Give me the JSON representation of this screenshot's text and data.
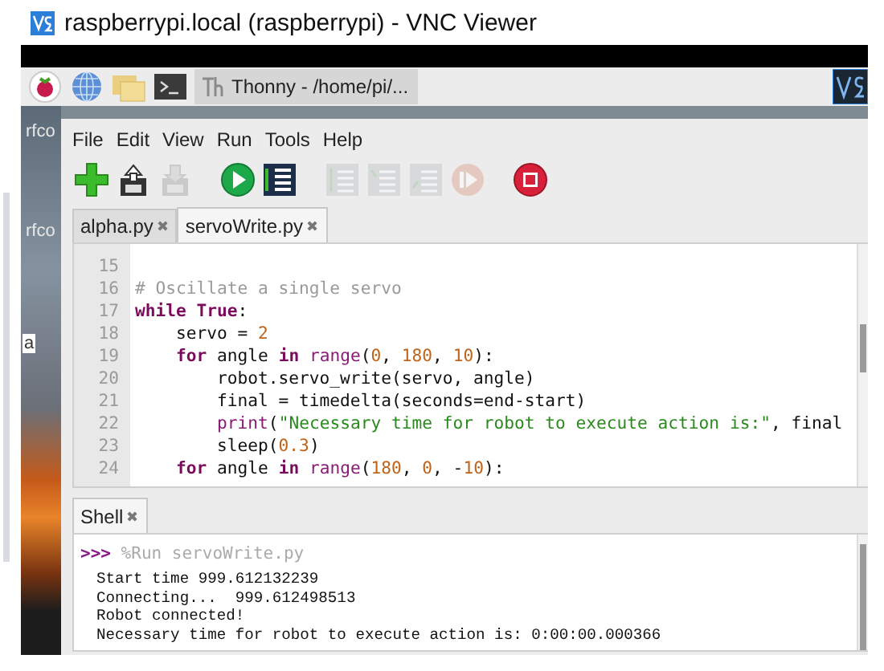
{
  "window": {
    "title": "raspberrypi.local (raspberrypi) - VNC Viewer"
  },
  "taskbar": {
    "window_button": "Thonny  -  /home/pi/..."
  },
  "desktop": {
    "labels": [
      {
        "text": "rfco"
      },
      {
        "text": "rfco"
      },
      {
        "text": "a"
      }
    ]
  },
  "thonny": {
    "menu": [
      "File",
      "Edit",
      "View",
      "Run",
      "Tools",
      "Help"
    ],
    "toolbar": [
      {
        "kind": "new",
        "disabled": false
      },
      {
        "kind": "load",
        "disabled": false
      },
      {
        "kind": "save",
        "disabled": true
      },
      {
        "kind": "run",
        "disabled": false
      },
      {
        "kind": "debug",
        "disabled": false
      },
      {
        "kind": "step-over",
        "disabled": true
      },
      {
        "kind": "step-into",
        "disabled": true
      },
      {
        "kind": "step-out",
        "disabled": true
      },
      {
        "kind": "resume",
        "disabled": true
      },
      {
        "kind": "stop",
        "disabled": false
      }
    ],
    "tabs": [
      {
        "label": "alpha.py",
        "close": "✖",
        "selected": false
      },
      {
        "label": "servoWrite.py",
        "close": "✖",
        "selected": true
      }
    ],
    "editor": {
      "lines": [
        {
          "number": "15"
        },
        {
          "number": "16",
          "tokens": [
            {
              "kind": "comment",
              "text": "# Oscillate a single servo"
            }
          ]
        },
        {
          "number": "17",
          "tokens": [
            {
              "kind": "keyword",
              "text": "while"
            },
            {
              "kind": "keyword",
              "text": " True"
            },
            {
              "kind": "plain",
              "text": ":"
            }
          ]
        },
        {
          "number": "18",
          "tokens": [
            {
              "kind": "plain",
              "text": "    servo = "
            },
            {
              "kind": "number",
              "text": "2"
            }
          ]
        },
        {
          "number": "19",
          "tokens": [
            {
              "kind": "keyword",
              "text": "    for"
            },
            {
              "kind": "plain",
              "text": " angle "
            },
            {
              "kind": "keyword",
              "text": "in"
            },
            {
              "kind": "builtin",
              "text": " range"
            },
            {
              "kind": "plain",
              "text": "("
            },
            {
              "kind": "number",
              "text": "0"
            },
            {
              "kind": "plain",
              "text": ", "
            },
            {
              "kind": "number",
              "text": "180"
            },
            {
              "kind": "plain",
              "text": ", "
            },
            {
              "kind": "number",
              "text": "10"
            },
            {
              "kind": "plain",
              "text": "):"
            }
          ]
        },
        {
          "number": "20",
          "tokens": [
            {
              "kind": "plain",
              "text": "        robot.servo_write(servo, angle)"
            }
          ]
        },
        {
          "number": "21",
          "tokens": [
            {
              "kind": "plain",
              "text": "        final = timedelta(seconds=end-start)"
            }
          ]
        },
        {
          "number": "22",
          "tokens": [
            {
              "kind": "builtin",
              "text": "        print"
            },
            {
              "kind": "plain",
              "text": "("
            },
            {
              "kind": "string",
              "text": "\"Necessary time for robot to execute action is:\""
            },
            {
              "kind": "plain",
              "text": ", final"
            }
          ]
        },
        {
          "number": "23",
          "tokens": [
            {
              "kind": "plain",
              "text": "        sleep("
            },
            {
              "kind": "number",
              "text": "0.3"
            },
            {
              "kind": "plain",
              "text": ")"
            }
          ]
        },
        {
          "number": "24",
          "tokens": [
            {
              "kind": "keyword",
              "text": "    for"
            },
            {
              "kind": "plain",
              "text": " angle "
            },
            {
              "kind": "keyword",
              "text": "in"
            },
            {
              "kind": "builtin",
              "text": " range"
            },
            {
              "kind": "plain",
              "text": "("
            },
            {
              "kind": "number",
              "text": "180"
            },
            {
              "kind": "plain",
              "text": ", "
            },
            {
              "kind": "number",
              "text": "0"
            },
            {
              "kind": "plain",
              "text": ", -"
            },
            {
              "kind": "number",
              "text": "10"
            },
            {
              "kind": "plain",
              "text": "):"
            }
          ]
        }
      ]
    },
    "shell": {
      "tab": {
        "label": "Shell",
        "close": "✖"
      },
      "prompt": ">>>",
      "command": "%Run servoWrite.py",
      "output": [
        "Start time 999.612132239",
        "Connecting...  999.612498513",
        "Robot connected!",
        "Necessary time for robot to execute action is: 0:00:00.000366"
      ]
    }
  }
}
